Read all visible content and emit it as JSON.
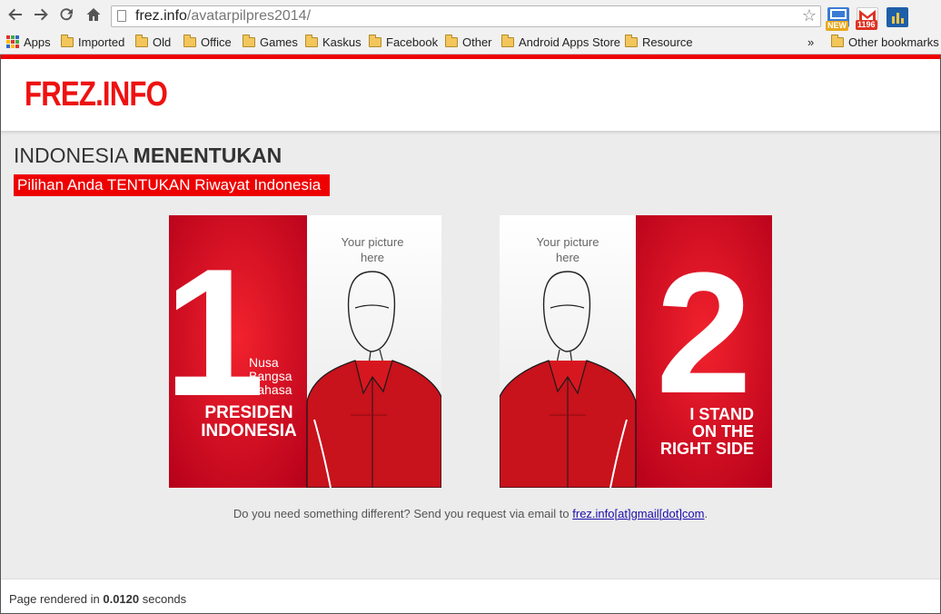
{
  "browser": {
    "url_host": "frez.info",
    "url_path": "/avatarpilpres2014/",
    "extensions": [
      {
        "name": "screen-extension",
        "badge": "NEW",
        "badge_color": "#e8a81c"
      },
      {
        "name": "gmail-extension",
        "badge": "1196",
        "badge_color": "#d32"
      },
      {
        "name": "stats-extension",
        "badge": ""
      }
    ],
    "bookmarks": [
      "Apps",
      "Imported",
      "Old",
      "Office",
      "Games",
      "Kaskus",
      "Facebook",
      "Other",
      "Android Apps Store",
      "Resource"
    ],
    "overflow": "»",
    "other_bookmarks": "Other bookmarks"
  },
  "site": {
    "logo": "FREZ.INFO",
    "heading_light": "INDONESIA ",
    "heading_bold": "MENENTUKAN",
    "tagline": "Pilihan Anda TENTUKAN Riwayat Indonesia",
    "accent_color": "#e00000"
  },
  "posters": [
    {
      "number": "1",
      "placeholder_line1": "Your picture",
      "placeholder_line2": "here",
      "sub_lines": [
        "Nusa",
        "Bangsa",
        "Bahasa"
      ],
      "caption_lines": [
        "PRESIDEN",
        "INDONESIA"
      ]
    },
    {
      "number": "2",
      "placeholder_line1": "Your picture",
      "placeholder_line2": "here",
      "caption_lines": [
        "I STAND",
        "ON THE",
        "RIGHT SIDE"
      ]
    }
  ],
  "footer_note": {
    "text": "Do you need something different? Send you request via email to ",
    "email": "frez.info[at]gmail[dot]com",
    "trailing": "."
  },
  "page_footer": {
    "prefix": "Page rendered in ",
    "time": "0.0120",
    "suffix": " seconds"
  }
}
